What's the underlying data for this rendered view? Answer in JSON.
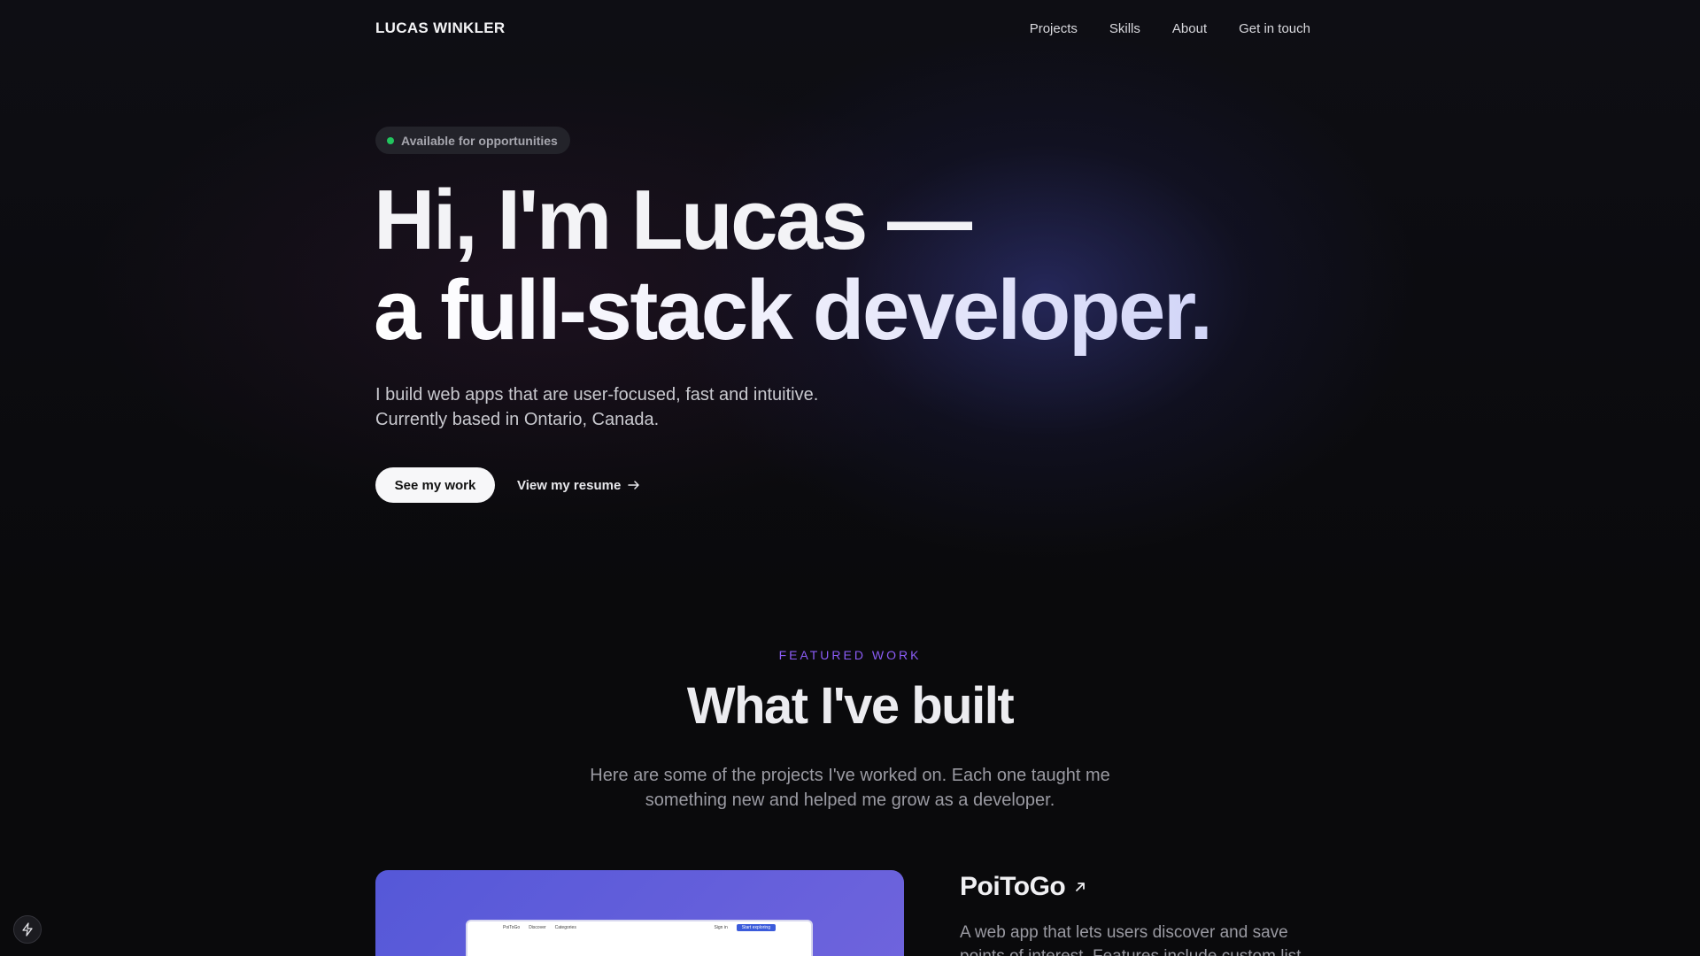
{
  "header": {
    "brand": "LUCAS WINKLER",
    "nav": [
      "Projects",
      "Skills",
      "About",
      "Get in touch"
    ]
  },
  "hero": {
    "badge": "Available for opportunities",
    "title_line1": "Hi, I'm Lucas —",
    "title_line2": "a full-stack developer.",
    "subtitle_line1": "I build web apps that are user-focused, fast and intuitive.",
    "subtitle_line2": "Currently based in Ontario, Canada.",
    "primary_button": "See my work",
    "secondary_link": "View my resume"
  },
  "featured": {
    "eyebrow": "FEATURED WORK",
    "title": "What I've built",
    "subtitle_line1": "Here are some of the projects I've worked on. Each one taught me",
    "subtitle_line2": "something new and helped me grow as a developer."
  },
  "project": {
    "title": "PoiToGo",
    "desc_line1": "A web app that lets users discover and save",
    "desc_line2": "points of interest. Features include custom list",
    "mock_brand": "PoiToGo",
    "mock_nav": [
      "Discover",
      "Categories"
    ],
    "mock_signin": "Sign in",
    "mock_cta": "Start exploring"
  },
  "colors": {
    "background": "#0a0a0c",
    "accent": "#8b5cf6",
    "status": "#22c55e",
    "card": "#5558d8"
  },
  "icons": {
    "status": "status-dot-icon",
    "resume": "arrow-right-icon",
    "project_link": "arrow-up-right-icon",
    "fab": "lightning-icon"
  }
}
